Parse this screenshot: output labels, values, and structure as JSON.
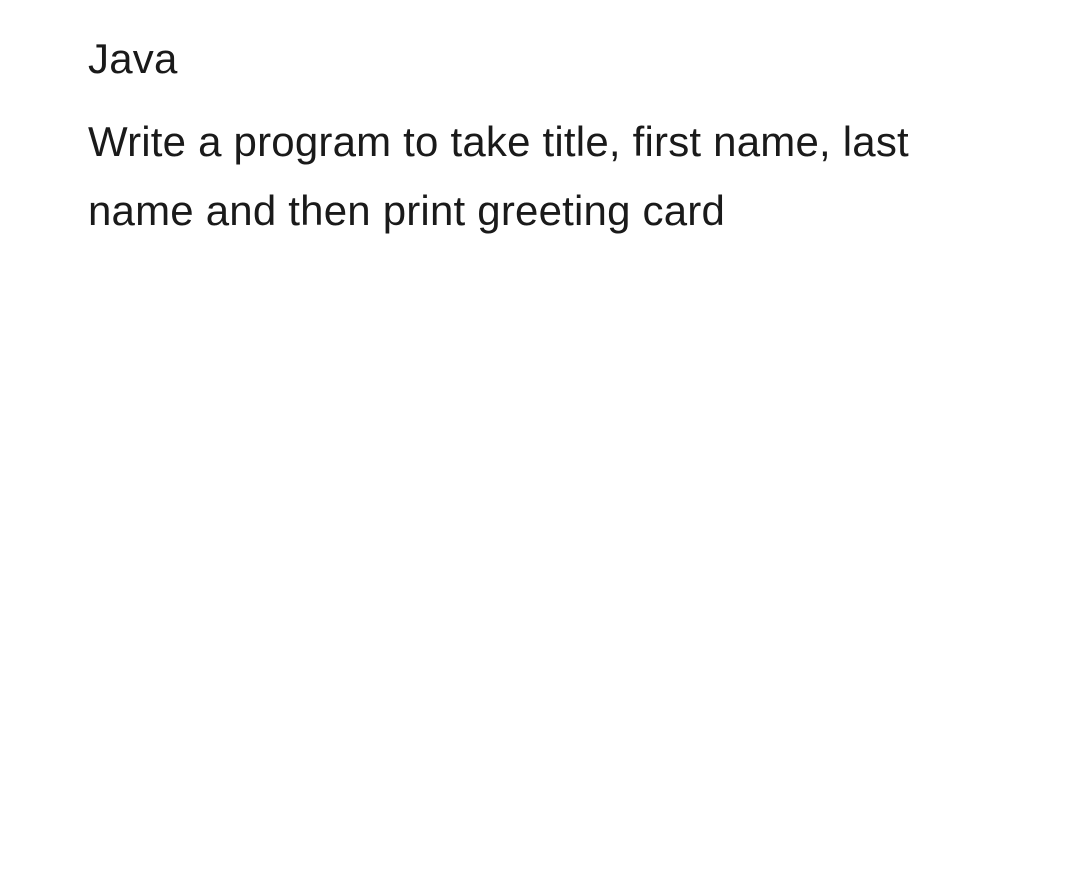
{
  "document": {
    "heading": "Java",
    "body": "Write a program to take title, first name, last name  and then print greeting card"
  }
}
